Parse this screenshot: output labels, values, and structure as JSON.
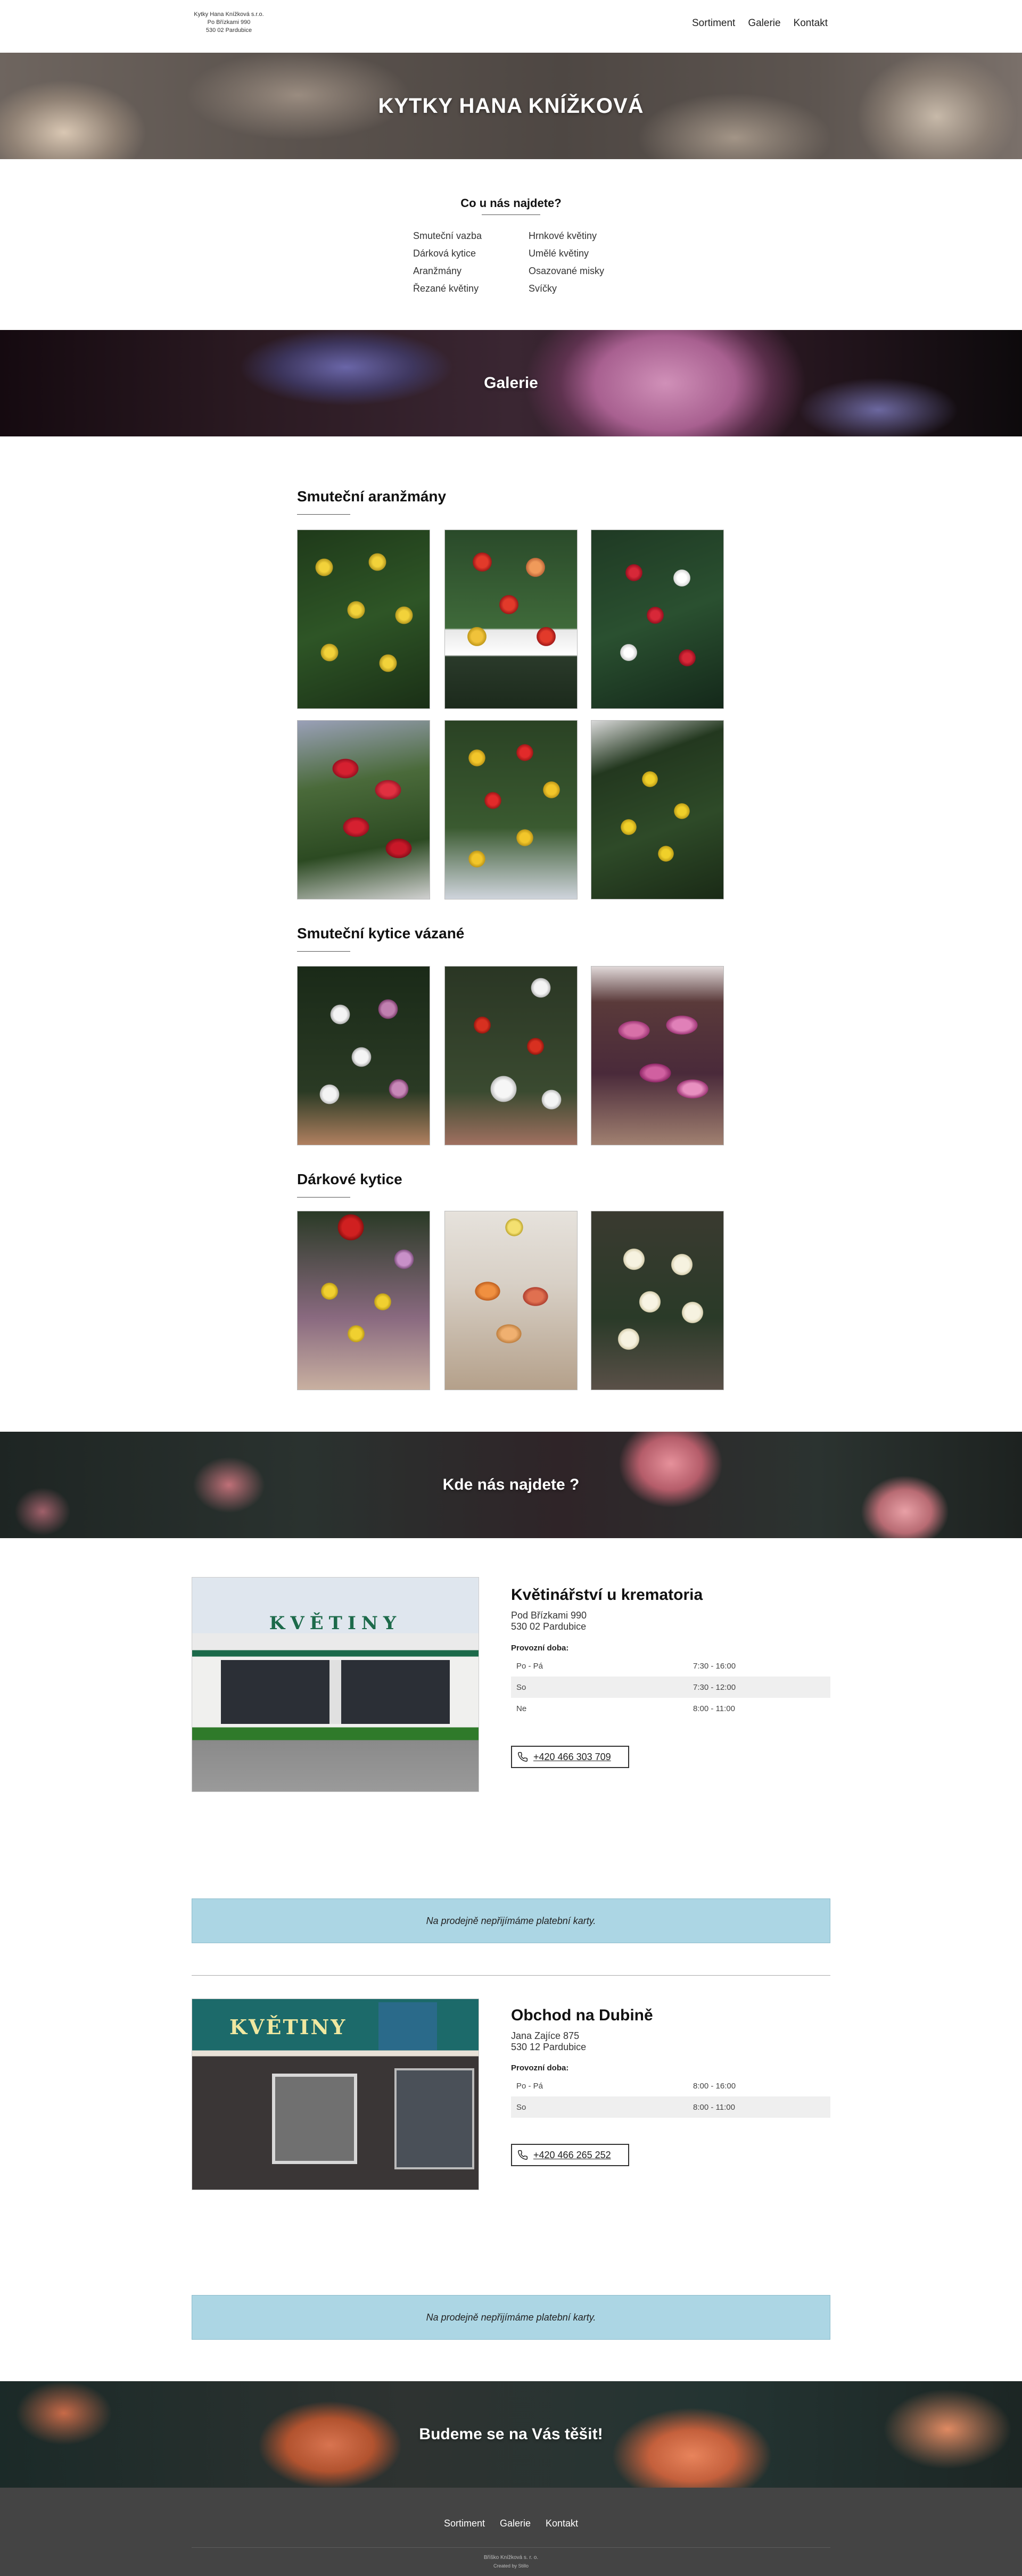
{
  "header": {
    "brand_line1": "Kytky Hana Knížková s.r.o.",
    "brand_line2": "Po Břízkami 990",
    "brand_line3": "530 02 Pardubice",
    "nav": [
      "Sortiment",
      "Galerie",
      "Kontakt"
    ]
  },
  "hero": {
    "title": "KYTKY HANA KNÍŽKOVÁ"
  },
  "sortiment": {
    "title": "Co u nás najdete?",
    "col1": [
      "Smuteční vazba",
      "Dárková kytice",
      "Aranžmány",
      "Řezané květiny"
    ],
    "col2": [
      "Hrnkové květiny",
      "Umělé květiny",
      "Osazované misky",
      "Svíčky"
    ]
  },
  "gallery": {
    "title": "Galerie",
    "sections": [
      {
        "title": "Smuteční aranžmány"
      },
      {
        "title": "Smuteční kytice vázané"
      },
      {
        "title": "Dárkové kytice"
      }
    ]
  },
  "contact": {
    "title": "Kde nás najdete ?"
  },
  "shops": [
    {
      "photo_sign": "KVĚTINY",
      "name": "Květinářství u krematoria",
      "addr1": "Pod Břízkami 990",
      "addr2": "530 02 Pardubice",
      "hours_label": "Provozní doba:",
      "hours": [
        {
          "day": "Po - Pá",
          "time": "7:30 - 16:00"
        },
        {
          "day": "So",
          "time": "7:30 - 12:00"
        },
        {
          "day": "Ne",
          "time": "8:00 - 11:00"
        }
      ],
      "phone": "+420 466 303 709",
      "notice": "Na prodejně nepřijímáme platební karty."
    },
    {
      "photo_sign": "KVĚTINY",
      "name": "Obchod na Dubině",
      "addr1": "Jana Zajíce 875",
      "addr2": "530 12 Pardubice",
      "hours_label": "Provozní doba:",
      "hours": [
        {
          "day": "Po - Pá",
          "time": "8:00 - 16:00"
        },
        {
          "day": "So",
          "time": "8:00 - 11:00"
        }
      ],
      "phone": "+420 466 265 252",
      "notice": "Na prodejně nepřijímáme platební karty."
    }
  ],
  "closing": {
    "title": "Budeme se na Vás těšit!"
  },
  "footer": {
    "nav": [
      "Sortiment",
      "Galerie",
      "Kontakt"
    ],
    "copyright": "Bříško Knížková s. r. o.",
    "created": "Created by Stillo"
  },
  "colors": {
    "notice_bg": "#acd6e4",
    "footer_bg": "#444444"
  }
}
